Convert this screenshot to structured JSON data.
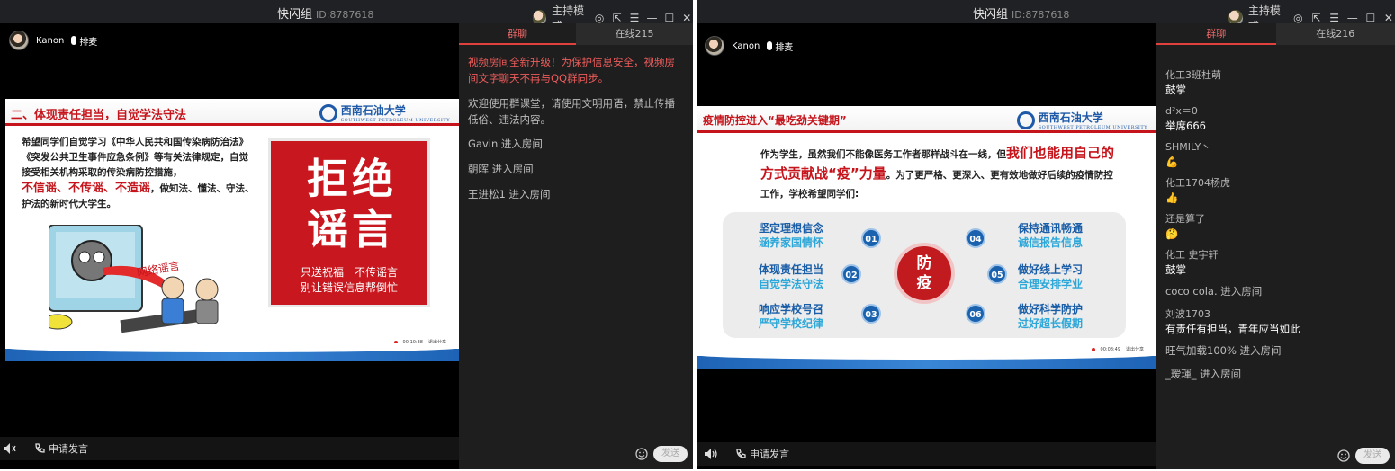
{
  "window1": {
    "title": "快闪组",
    "room_id": "ID:8787618",
    "mode_label": "主持模式",
    "presenter": {
      "name": "Kanon",
      "mic_label": "排麦"
    },
    "slide": {
      "heading": "二、体现责任担当，自觉学法守法",
      "logo_text": "西南石油大学",
      "logo_sub": "SOUTHWEST PETROLEUM UNIVERSITY",
      "body_1": "希望同学们自觉学习《中华人民共和国传染病防治法》《突发公共卫生事件应急条例》等有关法律规定，自觉接受相关机构采取的传染病防控措施，",
      "body_red": "不信谣、不传谣、不造谣",
      "body_2": "，做知法、懂法、守法、护法的新时代大学生。",
      "poster_big": "拒绝谣言",
      "poster_line1": "只送祝福　不传谣言",
      "poster_line2": "别让错误信息帮倒忙",
      "cartoon_text": "网络谣言",
      "timer": "00:10:38",
      "share_label": "退出分享"
    },
    "request_label": "申请发言",
    "tabs": [
      {
        "label": "群聊"
      },
      {
        "label": "在线215"
      }
    ],
    "chat": {
      "notice": "视频房间全新升级！为保护信息安全，视频房间文字聊天不再与QQ群同步。",
      "welcome": "欢迎使用群课堂，请使用文明用语，禁止传播低俗、违法内容。",
      "joins": [
        "Gavin 进入房间",
        "朝晖 进入房间",
        "王进松1 进入房间"
      ]
    },
    "send_label": "发送"
  },
  "window2": {
    "title": "快闪组",
    "room_id": "ID:8787618",
    "mode_label": "主持模式",
    "presenter": {
      "name": "Kanon",
      "mic_label": "排麦"
    },
    "slide": {
      "heading": "疫情防控进入“最吃劲关键期”",
      "logo_text": "西南石油大学",
      "logo_sub": "SOUTHWEST PETROLEUM UNIVERSITY",
      "text_1": "作为学生，虽然我们不能像医务工作者那样战斗在一线，但",
      "text_em": "我们也能用自己的方式贡献战“疫”力量",
      "text_2": "。为了更严格、更深入、更有效地做好后续的疫情防控工作，学校希望同学们:",
      "hub_line1": "防",
      "hub_line2": "疫",
      "items": [
        {
          "num": "01",
          "line1": "坚定理想信念",
          "line2": "涵养家国情怀"
        },
        {
          "num": "02",
          "line1": "体现责任担当",
          "line2": "自觉学法守法"
        },
        {
          "num": "03",
          "line1": "响应学校号召",
          "line2": "严守学校纪律"
        },
        {
          "num": "04",
          "line1": "保持通讯畅通",
          "line2": "诚信报告信息"
        },
        {
          "num": "05",
          "line1": "做好线上学习",
          "line2": "合理安排学业"
        },
        {
          "num": "06",
          "line1": "做好科学防护",
          "line2": "过好超长假期"
        }
      ],
      "timer": "00:08:49",
      "share_label": "退出分享"
    },
    "request_label": "申请发言",
    "tabs": [
      {
        "label": "群聊"
      },
      {
        "label": "在线216"
      }
    ],
    "chat": {
      "messages": [
        {
          "user": "化工3班杜萌",
          "text": "鼓掌"
        },
        {
          "user": "d²x＝0",
          "text": "举席666"
        },
        {
          "user": "SHMILY丶",
          "text": "💪"
        },
        {
          "user": "化工1704杨虎",
          "text": "👍"
        },
        {
          "user": "还是算了",
          "text": "🤔"
        },
        {
          "user": "化工 史宇轩",
          "text": "鼓掌"
        }
      ],
      "join_1": "coco cola. 进入房间",
      "msg_user": "刘波1703",
      "msg_text": "有责任有担当，青年应当如此",
      "join_2": "旺气加载100% 进入房间",
      "join_3": "_瑷琿_ 进入房间"
    },
    "send_label": "发送"
  }
}
